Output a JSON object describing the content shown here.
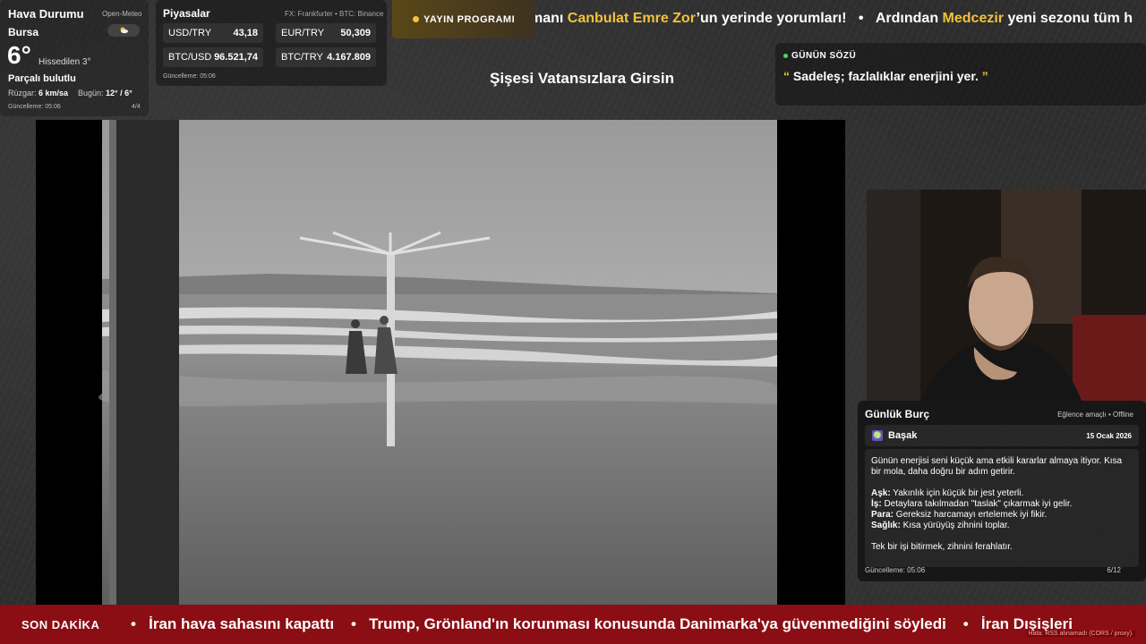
{
  "weather": {
    "title": "Hava Durumu",
    "source": "Open-Meteo",
    "city": "Bursa",
    "temp": "6°",
    "feels": "Hissedilen 3°",
    "condition": "Parçalı bulutlu",
    "wind_label": "Rüzgar:",
    "wind_value": "6 km/sa",
    "today_label": "Bugün:",
    "today_value": "12° / 6°",
    "updated": "Güncelleme: 05:06",
    "page": "4/4",
    "icon": "partly-cloudy-icon"
  },
  "markets": {
    "title": "Piyasalar",
    "source": "FX: Frankfurter • BTC: Binance",
    "rows": [
      {
        "label": "USD/TRY",
        "value": "43,18"
      },
      {
        "label": "EUR/TRY",
        "value": "50,309"
      },
      {
        "label": "BTC/USD",
        "value": "96.521,74"
      },
      {
        "label": "BTC/TRY",
        "value": "4.167.809"
      }
    ],
    "updated": "Güncelleme: 05:06"
  },
  "schedule": {
    "label": "YAYIN PROGRAMI"
  },
  "top_ticker": {
    "parts": [
      {
        "text": "manı ",
        "hl": false
      },
      {
        "text": "Canbulat Emre Zor",
        "hl": true
      },
      {
        "text": "’un yerinde yorumları!",
        "hl": false
      },
      {
        "text": "•",
        "hl": false
      },
      {
        "text": "Ardından ",
        "hl": false
      },
      {
        "text": "Medcezir",
        "hl": true
      },
      {
        "text": " yeni sezonu tüm h",
        "hl": false
      }
    ]
  },
  "now_playing": {
    "title": "Şişesi Vatansızlara Girsin"
  },
  "quote": {
    "label": "GÜNÜN SÖZÜ",
    "text": "Sadeleş; fazlalıklar enerjini yer.",
    "open": "“",
    "close": "”"
  },
  "horoscope": {
    "title": "Günlük Burç",
    "subtitle": "Eğlence amaçlı • Offline",
    "sign": "Başak",
    "sign_icon": "virgo-icon",
    "date": "15 Ocak 2026",
    "intro": "Günün enerjisi seni küçük ama etkili kararlar almaya itiyor. Kısa bir mola, daha doğru bir adım getirir.",
    "items": [
      {
        "k": "Aşk:",
        "v": " Yakınlık için küçük bir jest yeterli."
      },
      {
        "k": "İş:",
        "v": " Detaylara takılmadan \"taslak\" çıkarmak iyi gelir."
      },
      {
        "k": "Para:",
        "v": " Gereksiz harcamayı ertelemek iyi fikir."
      },
      {
        "k": "Sağlık:",
        "v": " Kısa yürüyüş zihnini toplar."
      }
    ],
    "outro": "Tek bir işi bitirmek, zihnini ferahlatır.",
    "updated": "Güncelleme: 05:06",
    "page": "6/12"
  },
  "breaking": {
    "label": "SON DAKİKA",
    "items": [
      "İran hava sahasını kapattı",
      "Trump, Grönland'ın korunması konusunda Danimarka'ya güvenmediğini söyledi",
      "İran Dışişleri"
    ],
    "error": "Hata: RSS alınamadı (CORS / proxy)."
  },
  "colors": {
    "accent_gold": "#f2c23a",
    "quote_green": "#4cd964",
    "breaking_red": "#8b0e14"
  }
}
